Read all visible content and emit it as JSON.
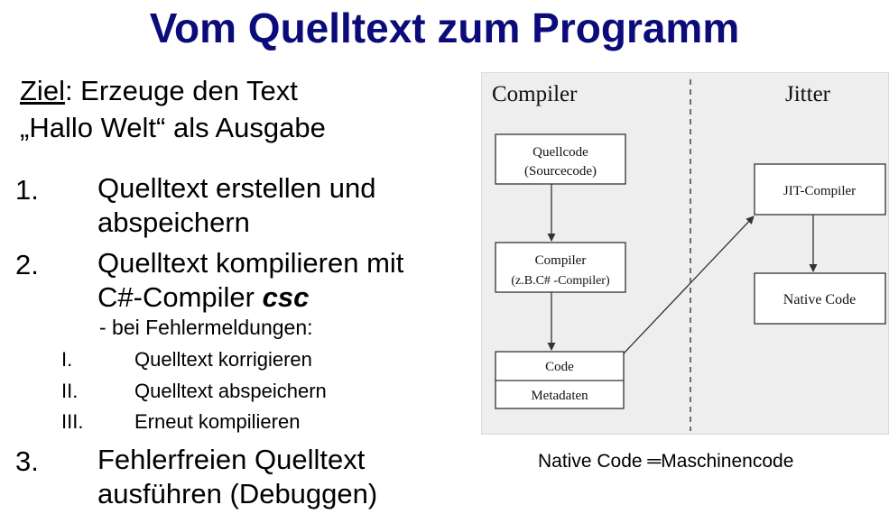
{
  "title": "Vom Quelltext zum Programm",
  "goal": {
    "label": "Ziel",
    "rest": ": Erzeuge den Text",
    "line2": "„Hallo Welt“ als Ausgabe"
  },
  "steps": [
    {
      "num": "1.",
      "line1": "Quelltext erstellen und",
      "line2": "abspeichern"
    },
    {
      "num": "2.",
      "line1": "Quelltext kompilieren mit",
      "line2_prefix": "C#-Compiler ",
      "line2_em": "csc",
      "sub": "- bei Fehlermeldungen:"
    },
    {
      "num": "3.",
      "line1": "Fehlerfreien Quelltext",
      "line2": "ausführen (Debuggen)"
    }
  ],
  "substeps": [
    {
      "num": "I.",
      "text": "Quelltext korrigieren"
    },
    {
      "num": "II.",
      "text": "Quelltext abspeichern"
    },
    {
      "num": "III.",
      "text": "Erneut kompilieren"
    }
  ],
  "diagram": {
    "left_header": "Compiler",
    "right_header": "Jitter",
    "source_box": [
      "Quellcode",
      "(Sourcecode)"
    ],
    "compiler_box": [
      "Compiler",
      "(z.B.C# -Compiler)"
    ],
    "code_label": "Code",
    "metadata_label": "Metadaten",
    "jit_box": "JIT-Compiler",
    "native_box": "Native Code"
  },
  "note": "Native Code ═Maschinencode",
  "colors": {
    "title": "#0b0b7a",
    "diagram_bg": "#eeeeee"
  }
}
